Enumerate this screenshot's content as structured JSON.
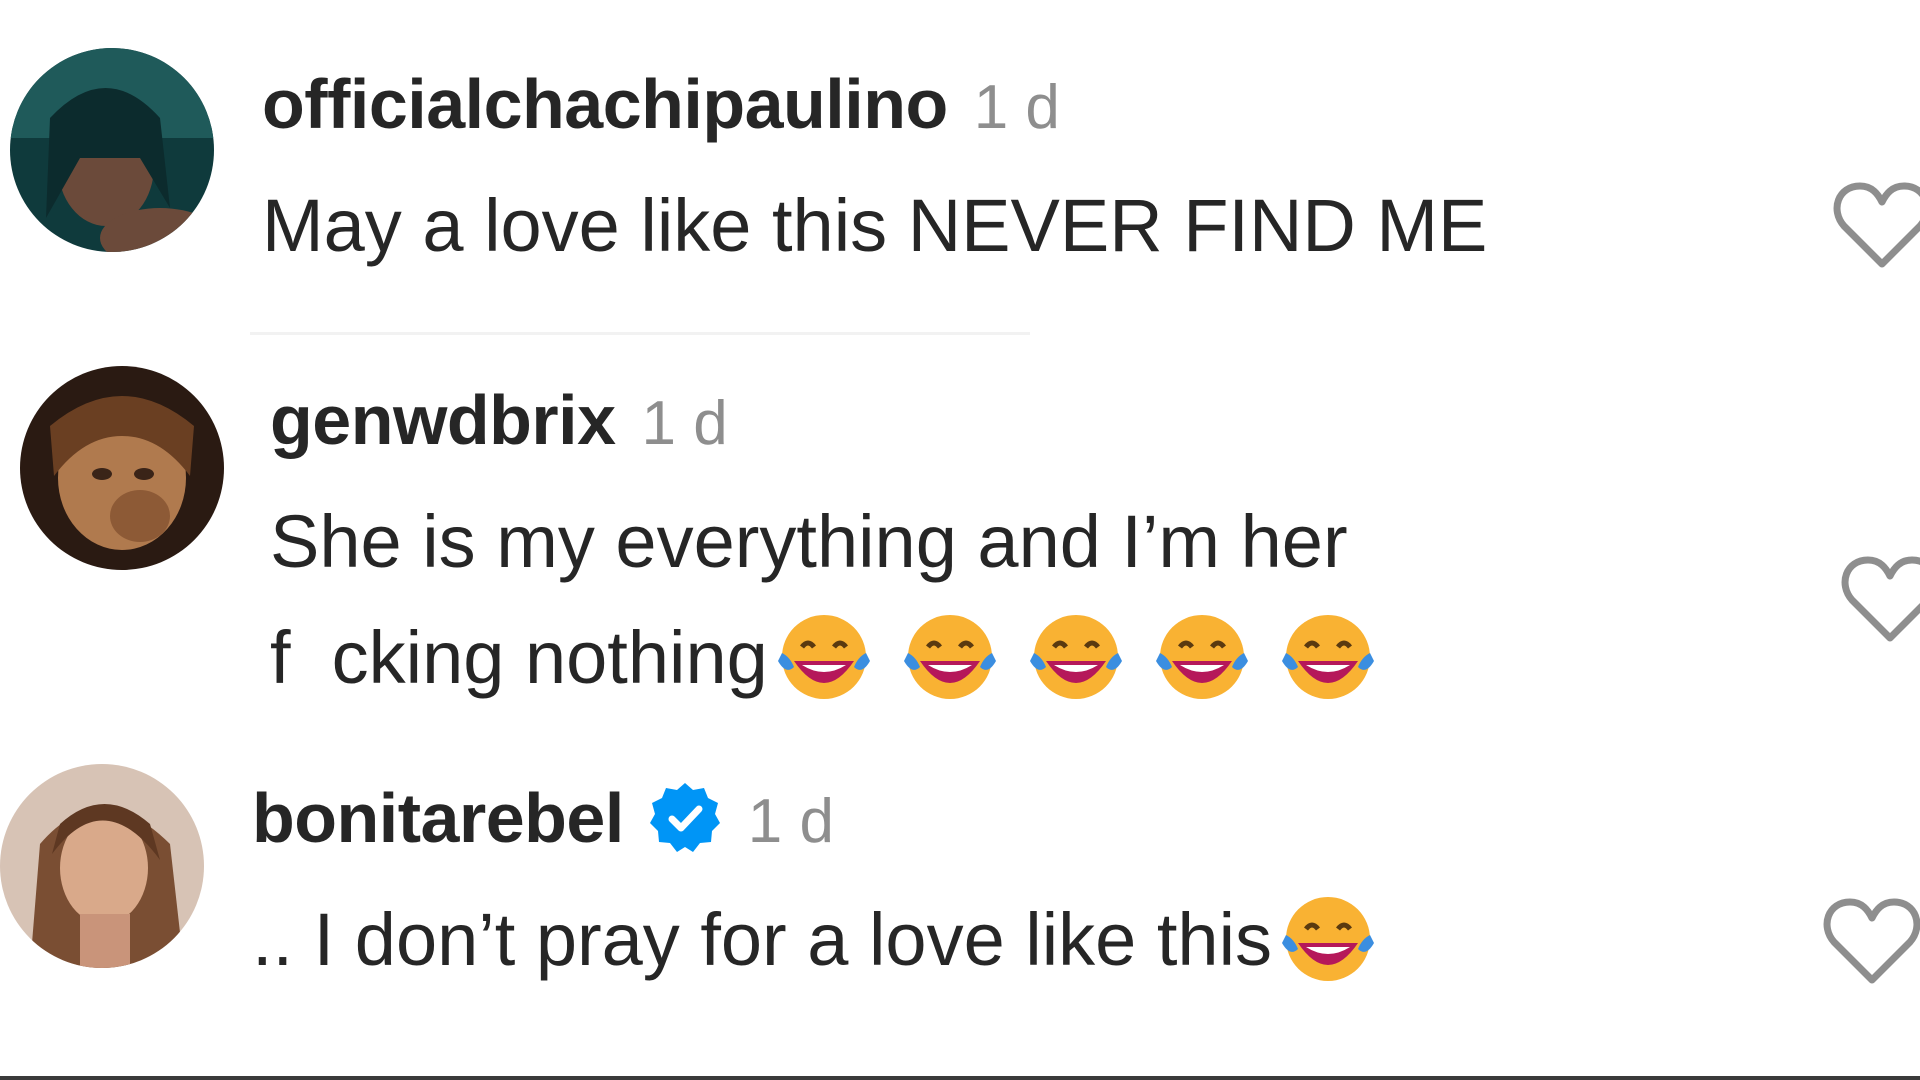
{
  "comments": [
    {
      "username": "officialchachipaulino",
      "time": "1 d",
      "verified": false,
      "text_lines": [
        "May a love like this NEVER FIND ME"
      ],
      "emoji_count": 0,
      "avatar_colors": [
        "#0f3a3c",
        "#6b4a3a"
      ]
    },
    {
      "username": "genwdbrix",
      "time": "1 d",
      "verified": false,
      "text_lines": [
        "She is my everything and I’m her",
        "f  cking nothing"
      ],
      "emoji_count": 5,
      "avatar_colors": [
        "#2a1a12",
        "#b07a4e"
      ]
    },
    {
      "username": "bonitarebel",
      "time": "1 d",
      "verified": true,
      "text_lines": [
        ".. I don’t pray for a love like this"
      ],
      "emoji_count": 1,
      "avatar_colors": [
        "#7a6a62",
        "#d7c3b5"
      ]
    }
  ],
  "icons": {
    "like": "heart-outline-icon",
    "verified": "verified-badge-icon",
    "emoji": "face-with-tears-of-joy-icon"
  },
  "colors": {
    "username": "#262626",
    "timestamp": "#8e8e8e",
    "verified": "#0095f6",
    "like_icon": "#8e8e8e"
  }
}
